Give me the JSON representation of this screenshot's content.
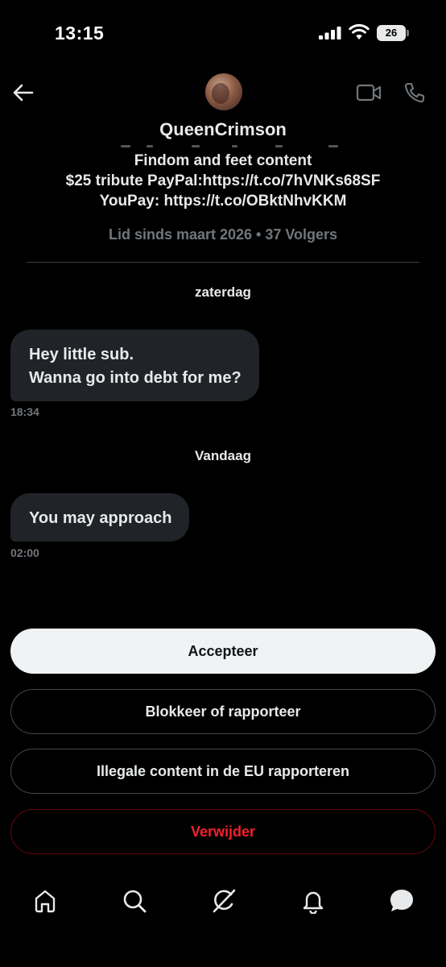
{
  "status_bar": {
    "time": "13:15",
    "battery": "26",
    "icons": [
      "cellular-signal-icon",
      "wifi-icon",
      "battery-icon"
    ]
  },
  "header": {
    "back_icon": "arrow-left-icon",
    "video_icon": "video-camera-icon",
    "call_icon": "phone-icon"
  },
  "profile": {
    "username": "QueenCrimson",
    "bio_lines": [
      "Findom and feet content",
      "$25 tribute PayPal:https://t.co/7hVNKs68SF",
      "YouPay: https://t.co/OBktNhvKKM"
    ],
    "meta": "Lid sinds maart 2026 • 37 Volgers"
  },
  "conversation": {
    "groups": [
      {
        "day": "zaterdag",
        "message_lines": [
          "Hey little sub.",
          "Wanna go into debt for me?"
        ],
        "time": "18:34"
      },
      {
        "day": "Vandaag",
        "message_lines": [
          "You may approach"
        ],
        "time": "02:00"
      }
    ]
  },
  "actions": {
    "accept": "Accepteer",
    "block_report": "Blokkeer of rapporteer",
    "report_eu": "Illegale content in de EU rapporteren",
    "delete": "Verwijder"
  },
  "bottom_nav": {
    "items": [
      "home-icon",
      "search-icon",
      "grok-icon",
      "notifications-icon",
      "messages-icon"
    ]
  },
  "colors": {
    "background": "#000000",
    "bubble": "#202327",
    "muted_text": "#71767b",
    "danger": "#f4212e",
    "accept_bg": "#eff3f4"
  }
}
